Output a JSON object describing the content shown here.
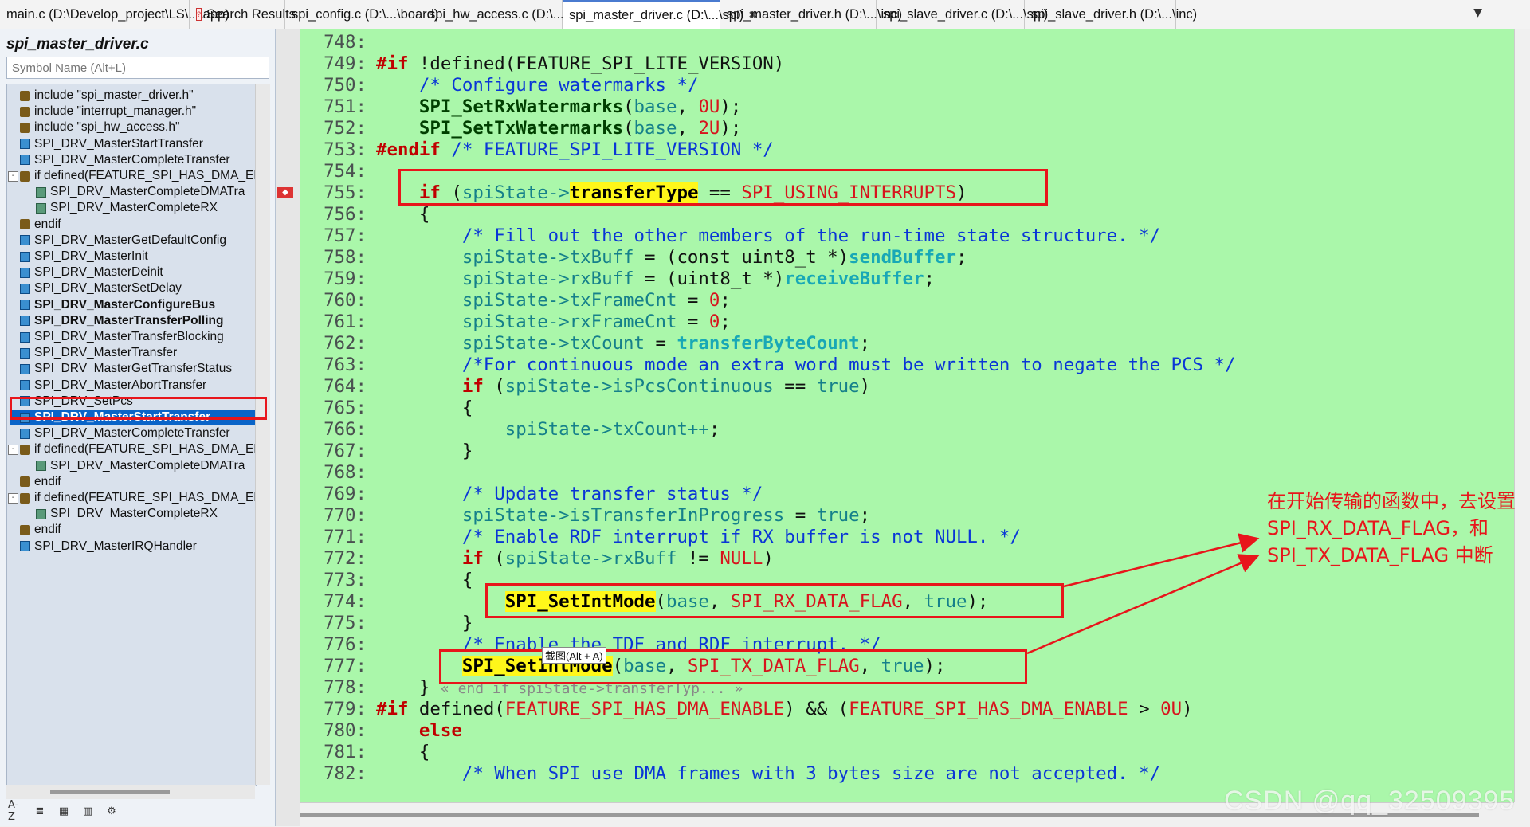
{
  "tabs": [
    {
      "label": "main.c (D:\\Develop_project\\LS\\...\\app)",
      "active": false,
      "icon": false
    },
    {
      "label": "Search Results",
      "active": false,
      "icon": true
    },
    {
      "label": "spi_config.c (D:\\...\\board)",
      "active": false,
      "icon": false
    },
    {
      "label": "spi_hw_access.c (D:\\...\\spi)",
      "active": false,
      "icon": false
    },
    {
      "label": "spi_master_driver.c (D:\\...\\spi)",
      "active": true,
      "icon": false
    },
    {
      "label": "spi_master_driver.h (D:\\...\\inc)",
      "active": false,
      "icon": false
    },
    {
      "label": "spi_slave_driver.c (D:\\...\\spi)",
      "active": false,
      "icon": false
    },
    {
      "label": "spi_slave_driver.h (D:\\...\\inc)",
      "active": false,
      "icon": false
    }
  ],
  "tab_close_glyph": "✖",
  "tab_dropdown_glyph": "▼",
  "sidebar": {
    "title": "spi_master_driver.c",
    "search_placeholder": "Symbol Name (Alt+L)",
    "items": [
      {
        "label": "include \"spi_master_driver.h\"",
        "type": "include",
        "indent": 0
      },
      {
        "label": "include \"interrupt_manager.h\"",
        "type": "include",
        "indent": 0
      },
      {
        "label": "include \"spi_hw_access.h\"",
        "type": "include",
        "indent": 0
      },
      {
        "label": "SPI_DRV_MasterStartTransfer",
        "type": "function",
        "indent": 0
      },
      {
        "label": "SPI_DRV_MasterCompleteTransfer",
        "type": "function",
        "indent": 0
      },
      {
        "label": "if defined(FEATURE_SPI_HAS_DMA_EN",
        "type": "include",
        "indent": 0,
        "expander": "-"
      },
      {
        "label": "SPI_DRV_MasterCompleteDMATra",
        "type": "sub",
        "indent": 1
      },
      {
        "label": "SPI_DRV_MasterCompleteRX",
        "type": "sub",
        "indent": 1
      },
      {
        "label": "endif",
        "type": "include",
        "indent": 0
      },
      {
        "label": "SPI_DRV_MasterGetDefaultConfig",
        "type": "function",
        "indent": 0
      },
      {
        "label": "SPI_DRV_MasterInit",
        "type": "function",
        "indent": 0
      },
      {
        "label": "SPI_DRV_MasterDeinit",
        "type": "function",
        "indent": 0
      },
      {
        "label": "SPI_DRV_MasterSetDelay",
        "type": "function",
        "indent": 0
      },
      {
        "label": "SPI_DRV_MasterConfigureBus",
        "type": "function",
        "indent": 0,
        "bold": true
      },
      {
        "label": "SPI_DRV_MasterTransferPolling",
        "type": "function",
        "indent": 0,
        "bold": true
      },
      {
        "label": "SPI_DRV_MasterTransferBlocking",
        "type": "function",
        "indent": 0
      },
      {
        "label": "SPI_DRV_MasterTransfer",
        "type": "function",
        "indent": 0
      },
      {
        "label": "SPI_DRV_MasterGetTransferStatus",
        "type": "function",
        "indent": 0
      },
      {
        "label": "SPI_DRV_MasterAbortTransfer",
        "type": "function",
        "indent": 0
      },
      {
        "label": "SPI_DRV_SetPcs",
        "type": "function",
        "indent": 0
      },
      {
        "label": "SPI_DRV_MasterStartTransfer",
        "type": "function",
        "indent": 0,
        "selected": true
      },
      {
        "label": "SPI_DRV_MasterCompleteTransfer",
        "type": "function",
        "indent": 0
      },
      {
        "label": "if defined(FEATURE_SPI_HAS_DMA_EN",
        "type": "include",
        "indent": 0,
        "expander": "-"
      },
      {
        "label": "SPI_DRV_MasterCompleteDMATra",
        "type": "sub",
        "indent": 1
      },
      {
        "label": "endif",
        "type": "include",
        "indent": 0
      },
      {
        "label": "if defined(FEATURE_SPI_HAS_DMA_EN",
        "type": "include",
        "indent": 0,
        "expander": "-"
      },
      {
        "label": "SPI_DRV_MasterCompleteRX",
        "type": "sub",
        "indent": 1
      },
      {
        "label": "endif",
        "type": "include",
        "indent": 0
      },
      {
        "label": "SPI_DRV_MasterIRQHandler",
        "type": "function",
        "indent": 0
      }
    ],
    "toolbar": [
      "A-Z",
      "≣",
      "▦",
      "▥",
      "⚙"
    ]
  },
  "code_lines": [
    {
      "n": "748:",
      "tokens": []
    },
    {
      "n": "749:",
      "tokens": [
        [
          "pp",
          "#if"
        ],
        [
          "plain",
          " !defined(FEATURE_SPI_LITE_VERSION)"
        ]
      ]
    },
    {
      "n": "750:",
      "tokens": [
        [
          "plain",
          "    "
        ],
        [
          "cm",
          "/* Configure watermarks */"
        ]
      ]
    },
    {
      "n": "751:",
      "tokens": [
        [
          "plain",
          "    "
        ],
        [
          "fn",
          "SPI_SetRxWatermarks"
        ],
        [
          "plain",
          "("
        ],
        [
          "id",
          "base"
        ],
        [
          "plain",
          ", "
        ],
        [
          "num",
          "0U"
        ],
        [
          "plain",
          ");"
        ]
      ]
    },
    {
      "n": "752:",
      "tokens": [
        [
          "plain",
          "    "
        ],
        [
          "fn",
          "SPI_SetTxWatermarks"
        ],
        [
          "plain",
          "("
        ],
        [
          "id",
          "base"
        ],
        [
          "plain",
          ", "
        ],
        [
          "num",
          "2U"
        ],
        [
          "plain",
          ");"
        ]
      ]
    },
    {
      "n": "753:",
      "tokens": [
        [
          "pp",
          "#endif"
        ],
        [
          "plain",
          " "
        ],
        [
          "cm",
          "/* FEATURE_SPI_LITE_VERSION */"
        ]
      ]
    },
    {
      "n": "754:",
      "tokens": []
    },
    {
      "n": "755:",
      "tokens": [
        [
          "plain",
          "    "
        ],
        [
          "kw",
          "if"
        ],
        [
          "plain",
          " ("
        ],
        [
          "id",
          "spiState->"
        ],
        [
          "hl",
          "transferType"
        ],
        [
          "plain",
          " == "
        ],
        [
          "mac",
          "SPI_USING_INTERRUPTS"
        ],
        [
          "plain",
          ")"
        ]
      ]
    },
    {
      "n": "756:",
      "tokens": [
        [
          "plain",
          "    {"
        ]
      ]
    },
    {
      "n": "757:",
      "tokens": [
        [
          "plain",
          "        "
        ],
        [
          "cm",
          "/* Fill out the other members of the run-time state structure. */"
        ]
      ]
    },
    {
      "n": "758:",
      "tokens": [
        [
          "plain",
          "        "
        ],
        [
          "id",
          "spiState->txBuff"
        ],
        [
          "plain",
          " = (const uint8_t *)"
        ],
        [
          "var",
          "sendBuffer"
        ],
        [
          "plain",
          ";"
        ]
      ]
    },
    {
      "n": "759:",
      "tokens": [
        [
          "plain",
          "        "
        ],
        [
          "id",
          "spiState->rxBuff"
        ],
        [
          "plain",
          " = (uint8_t *)"
        ],
        [
          "var",
          "receiveBuffer"
        ],
        [
          "plain",
          ";"
        ]
      ]
    },
    {
      "n": "760:",
      "tokens": [
        [
          "plain",
          "        "
        ],
        [
          "id",
          "spiState->txFrameCnt"
        ],
        [
          "plain",
          " = "
        ],
        [
          "num",
          "0"
        ],
        [
          "plain",
          ";"
        ]
      ]
    },
    {
      "n": "761:",
      "tokens": [
        [
          "plain",
          "        "
        ],
        [
          "id",
          "spiState->rxFrameCnt"
        ],
        [
          "plain",
          " = "
        ],
        [
          "num",
          "0"
        ],
        [
          "plain",
          ";"
        ]
      ]
    },
    {
      "n": "762:",
      "tokens": [
        [
          "plain",
          "        "
        ],
        [
          "id",
          "spiState->txCount"
        ],
        [
          "plain",
          " = "
        ],
        [
          "var",
          "transferByteCount"
        ],
        [
          "plain",
          ";"
        ]
      ]
    },
    {
      "n": "763:",
      "tokens": [
        [
          "plain",
          "        "
        ],
        [
          "cm",
          "/*For continuous mode an extra word must be written to negate the PCS */"
        ]
      ]
    },
    {
      "n": "764:",
      "tokens": [
        [
          "plain",
          "        "
        ],
        [
          "kw",
          "if"
        ],
        [
          "plain",
          " ("
        ],
        [
          "id",
          "spiState->isPcsContinuous"
        ],
        [
          "plain",
          " == "
        ],
        [
          "id",
          "true"
        ],
        [
          "plain",
          ")"
        ]
      ]
    },
    {
      "n": "765:",
      "tokens": [
        [
          "plain",
          "        {"
        ]
      ]
    },
    {
      "n": "766:",
      "tokens": [
        [
          "plain",
          "            "
        ],
        [
          "id",
          "spiState->txCount++"
        ],
        [
          "plain",
          ";"
        ]
      ]
    },
    {
      "n": "767:",
      "tokens": [
        [
          "plain",
          "        }"
        ]
      ]
    },
    {
      "n": "768:",
      "tokens": []
    },
    {
      "n": "769:",
      "tokens": [
        [
          "plain",
          "        "
        ],
        [
          "cm",
          "/* Update transfer status */"
        ]
      ]
    },
    {
      "n": "770:",
      "tokens": [
        [
          "plain",
          "        "
        ],
        [
          "id",
          "spiState->isTransferInProgress"
        ],
        [
          "plain",
          " = "
        ],
        [
          "id",
          "true"
        ],
        [
          "plain",
          ";"
        ]
      ]
    },
    {
      "n": "771:",
      "tokens": [
        [
          "plain",
          "        "
        ],
        [
          "cm",
          "/* Enable RDF interrupt if RX buffer is not NULL. */"
        ]
      ]
    },
    {
      "n": "772:",
      "tokens": [
        [
          "plain",
          "        "
        ],
        [
          "kw",
          "if"
        ],
        [
          "plain",
          " ("
        ],
        [
          "id",
          "spiState->rxBuff"
        ],
        [
          "plain",
          " != "
        ],
        [
          "mac",
          "NULL"
        ],
        [
          "plain",
          ")"
        ]
      ]
    },
    {
      "n": "773:",
      "tokens": [
        [
          "plain",
          "        {"
        ]
      ]
    },
    {
      "n": "774:",
      "tokens": [
        [
          "plain",
          "            "
        ],
        [
          "hl",
          "SPI_SetIntMode"
        ],
        [
          "plain",
          "("
        ],
        [
          "id",
          "base"
        ],
        [
          "plain",
          ", "
        ],
        [
          "mac",
          "SPI_RX_DATA_FLAG"
        ],
        [
          "plain",
          ", "
        ],
        [
          "id",
          "true"
        ],
        [
          "plain",
          ");"
        ]
      ]
    },
    {
      "n": "775:",
      "tokens": [
        [
          "plain",
          "        }"
        ]
      ]
    },
    {
      "n": "776:",
      "tokens": [
        [
          "plain",
          "        "
        ],
        [
          "cm",
          "/* Enable the TDF and RDF interrupt. */"
        ]
      ]
    },
    {
      "n": "777:",
      "tokens": [
        [
          "plain",
          "        "
        ],
        [
          "hl",
          "SPI_SetIntMode"
        ],
        [
          "plain",
          "("
        ],
        [
          "id",
          "base"
        ],
        [
          "plain",
          ", "
        ],
        [
          "mac",
          "SPI_TX_DATA_FLAG"
        ],
        [
          "plain",
          ", "
        ],
        [
          "id",
          "true"
        ],
        [
          "plain",
          ");"
        ]
      ]
    },
    {
      "n": "778:",
      "tokens": [
        [
          "plain",
          "    } "
        ],
        [
          "ghost",
          "« end if spiState->transferTyp... »"
        ]
      ]
    },
    {
      "n": "779:",
      "tokens": [
        [
          "pp",
          "#if"
        ],
        [
          "plain",
          " defined("
        ],
        [
          "mac",
          "FEATURE_SPI_HAS_DMA_ENABLE"
        ],
        [
          "plain",
          ") && ("
        ],
        [
          "mac",
          "FEATURE_SPI_HAS_DMA_ENABLE"
        ],
        [
          "plain",
          " > "
        ],
        [
          "num",
          "0U"
        ],
        [
          "plain",
          ")"
        ]
      ]
    },
    {
      "n": "780:",
      "tokens": [
        [
          "plain",
          "    "
        ],
        [
          "kw",
          "else"
        ]
      ]
    },
    {
      "n": "781:",
      "tokens": [
        [
          "plain",
          "    {"
        ]
      ]
    },
    {
      "n": "782:",
      "tokens": [
        [
          "plain",
          "        "
        ],
        [
          "cm",
          "/* When SPI use DMA frames with 3 bytes size are not accepted. */"
        ]
      ]
    }
  ],
  "tooltip": "截图(Alt + A)",
  "annotation": "在开始传输的函数中，去设置 SPI_RX_DATA_FLAG，和 SPI_TX_DATA_FLAG 中断",
  "watermark": "CSDN @qq_32509395",
  "colors": {
    "editor_bg": "#aaf7aa",
    "highlight": "#fff71a",
    "annotation_red": "#e8151b",
    "selection_blue": "#0a64c8"
  }
}
